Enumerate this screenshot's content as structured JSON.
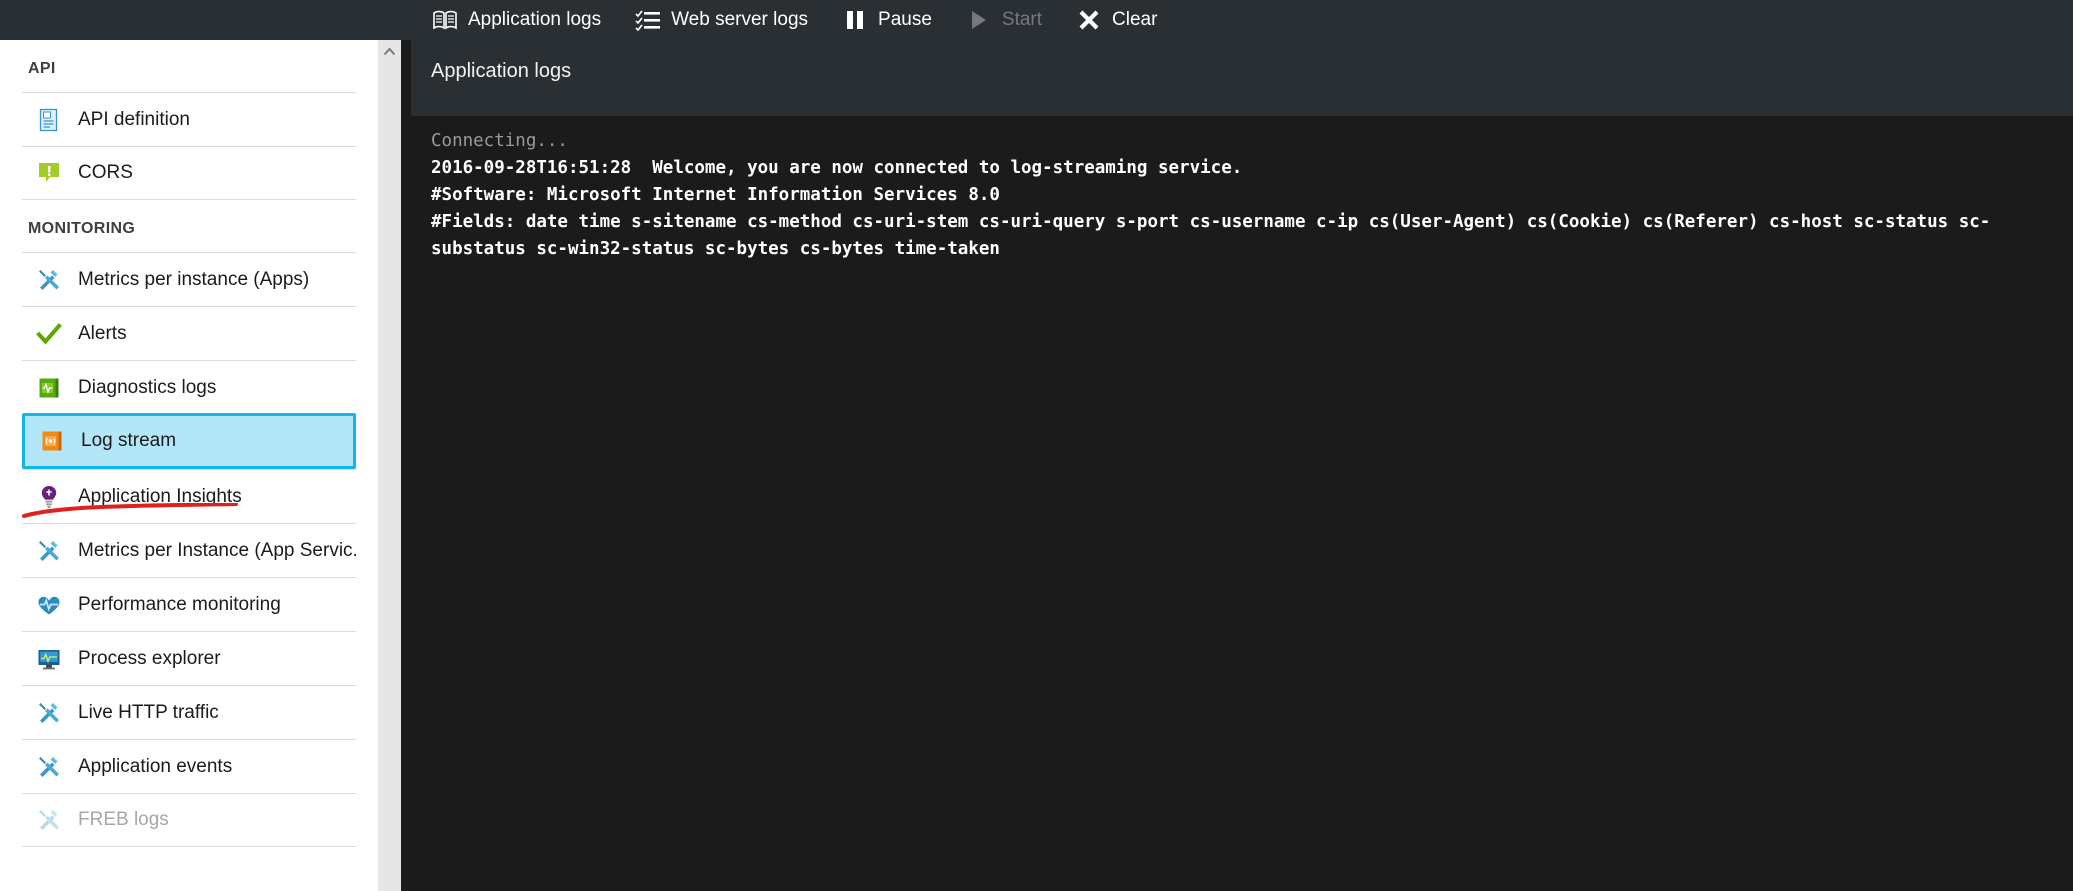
{
  "toolbar": {
    "commands": [
      {
        "label": "Application logs",
        "icon": "book-icon",
        "disabled": false
      },
      {
        "label": "Web server logs",
        "icon": "checklist-icon",
        "disabled": false
      },
      {
        "label": "Pause",
        "icon": "pause-icon",
        "disabled": false
      },
      {
        "label": "Start",
        "icon": "play-icon",
        "disabled": true
      },
      {
        "label": "Clear",
        "icon": "close-x-icon",
        "disabled": false
      }
    ]
  },
  "main": {
    "title": "Application logs",
    "console_lines": [
      {
        "text": "Connecting...",
        "muted": true
      },
      {
        "text": "2016-09-28T16:51:28  Welcome, you are now connected to log-streaming service.",
        "muted": false
      },
      {
        "text": "#Software: Microsoft Internet Information Services 8.0",
        "muted": false
      },
      {
        "text": "#Fields: date time s-sitename cs-method cs-uri-stem cs-uri-query s-port cs-username c-ip cs(User-Agent) cs(Cookie) cs(Referer) cs-host sc-status sc-substatus sc-win32-status sc-bytes cs-bytes time-taken",
        "muted": false
      }
    ]
  },
  "sidebar": {
    "sections": [
      {
        "title": "API",
        "items": [
          {
            "label": "API definition",
            "icon": "api-definition-icon",
            "state": "normal"
          },
          {
            "label": "CORS",
            "icon": "cors-icon",
            "state": "normal"
          }
        ]
      },
      {
        "title": "MONITORING",
        "items": [
          {
            "label": "Metrics per instance (Apps)",
            "icon": "tools-icon",
            "state": "normal"
          },
          {
            "label": "Alerts",
            "icon": "checkmark-icon",
            "state": "normal"
          },
          {
            "label": "Diagnostics logs",
            "icon": "diagnostics-book-icon",
            "state": "normal"
          },
          {
            "label": "Log stream",
            "icon": "log-stream-book-icon",
            "state": "selected"
          },
          {
            "label": "Application Insights",
            "icon": "lightbulb-icon",
            "state": "normal"
          },
          {
            "label": "Metrics per Instance (App Servic...",
            "icon": "tools-icon",
            "state": "normal"
          },
          {
            "label": "Performance monitoring",
            "icon": "heart-pulse-icon",
            "state": "normal"
          },
          {
            "label": "Process explorer",
            "icon": "monitor-icon",
            "state": "normal"
          },
          {
            "label": "Live HTTP traffic",
            "icon": "tools-icon",
            "state": "normal"
          },
          {
            "label": "Application events",
            "icon": "tools-icon",
            "state": "normal"
          },
          {
            "label": "FREB logs",
            "icon": "tools-icon",
            "state": "disabled"
          }
        ]
      }
    ]
  },
  "colors": {
    "topbar_bg": "#2a2f34",
    "console_bg": "#1b1b1b",
    "selection_fill": "#b3e7f7",
    "selection_border": "#15b4e9",
    "annotation_red": "#e0201b",
    "accent_blue": "#3a96c8",
    "accent_green": "#7ab800",
    "accent_orange": "#f0860b"
  }
}
